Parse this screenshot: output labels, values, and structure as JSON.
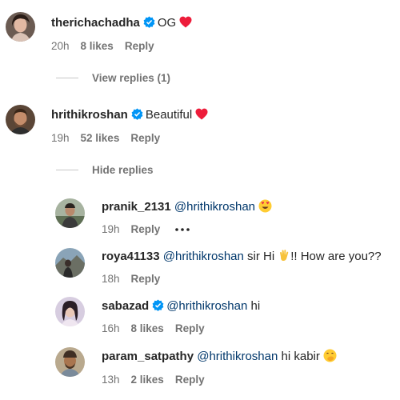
{
  "comments": [
    {
      "username": "therichachadha",
      "text": "OG",
      "time": "20h",
      "likes": "8 likes",
      "reply": "Reply"
    },
    {
      "username": "hrithikroshan",
      "text": "Beautiful",
      "time": "19h",
      "likes": "52 likes",
      "reply": "Reply"
    }
  ],
  "toggles": {
    "view_replies": "View replies (1)",
    "hide_replies": "Hide replies"
  },
  "replies": [
    {
      "username": "pranik_2131",
      "mention": "@hrithikroshan",
      "text": "",
      "time": "19h",
      "reply": "Reply"
    },
    {
      "username": "roya41133",
      "mention": "@hrithikroshan",
      "text_before": "sir Hi",
      "text_after": "!! How are you??",
      "time": "18h",
      "reply": "Reply"
    },
    {
      "username": "sabazad",
      "mention": "@hrithikroshan",
      "text": "hi",
      "time": "16h",
      "likes": "8 likes",
      "reply": "Reply"
    },
    {
      "username": "param_satpathy",
      "mention": "@hrithikroshan",
      "text": "hi kabir",
      "time": "13h",
      "likes": "2 likes",
      "reply": "Reply"
    }
  ],
  "icons": {
    "verified": "verified-badge-icon",
    "heart": "red-heart-icon",
    "more": "more-options-icon"
  },
  "colors": {
    "text": "#262626",
    "meta": "#737373",
    "mention": "#00376b",
    "verified": "#0095f6",
    "heart": "#ed1c3a"
  }
}
